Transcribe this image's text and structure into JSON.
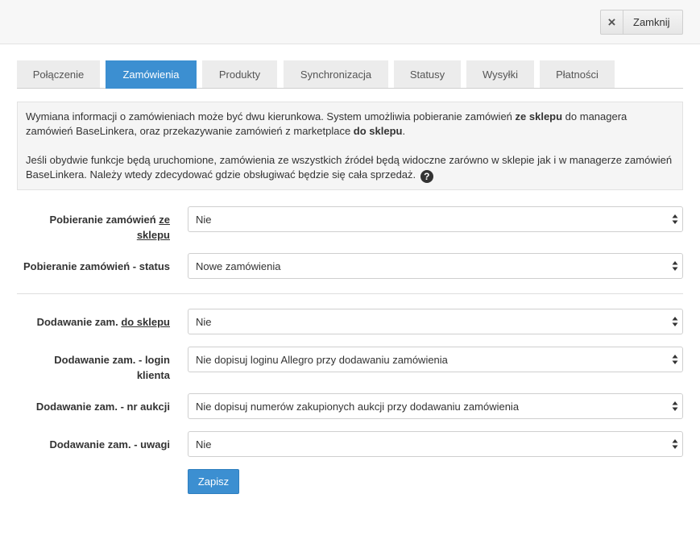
{
  "header": {
    "close_label": "Zamknij",
    "close_icon": "×"
  },
  "tabs": [
    {
      "label": "Połączenie",
      "active": false
    },
    {
      "label": "Zamówienia",
      "active": true
    },
    {
      "label": "Produkty",
      "active": false
    },
    {
      "label": "Synchronizacja",
      "active": false
    },
    {
      "label": "Statusy",
      "active": false
    },
    {
      "label": "Wysyłki",
      "active": false
    },
    {
      "label": "Płatności",
      "active": false
    }
  ],
  "info": {
    "p1_a": "Wymiana informacji o zamówieniach może być dwu kierunkowa. System umożliwia pobieranie zamówień ",
    "p1_b": "ze sklepu",
    "p1_c": " do managera zamówień BaseLinkera, oraz przekazywanie zamówień z marketplace ",
    "p1_d": "do sklepu",
    "p1_e": ".",
    "p2": "Jeśli obydwie funkcje będą uruchomione, zamówienia ze wszystkich źródeł będą widoczne zarówno w sklepie jak i w managerze zamówień BaseLinkera. Należy wtedy zdecydować gdzie obsługiwać będzie się cała sprzedaż.",
    "help_icon": "?"
  },
  "form": {
    "f1_label_a": "Pobieranie zamówień ",
    "f1_label_u1": "ze",
    "f1_label_u2": "sklepu",
    "f1_value": "Nie",
    "f2_label": "Pobieranie zamówień - status",
    "f2_value": "Nowe zamówienia",
    "f3_label_a": "Dodawanie zam. ",
    "f3_label_u": "do sklepu",
    "f3_value": "Nie",
    "f4_label_1": "Dodawanie zam. - login",
    "f4_label_2": "klienta",
    "f4_value": "Nie dopisuj loginu Allegro przy dodawaniu zamówienia",
    "f5_label": "Dodawanie zam. - nr aukcji",
    "f5_value": "Nie dopisuj numerów zakupionych aukcji przy dodawaniu zamówienia",
    "f6_label": "Dodawanie zam. - uwagi",
    "f6_value": "Nie",
    "save_label": "Zapisz"
  }
}
